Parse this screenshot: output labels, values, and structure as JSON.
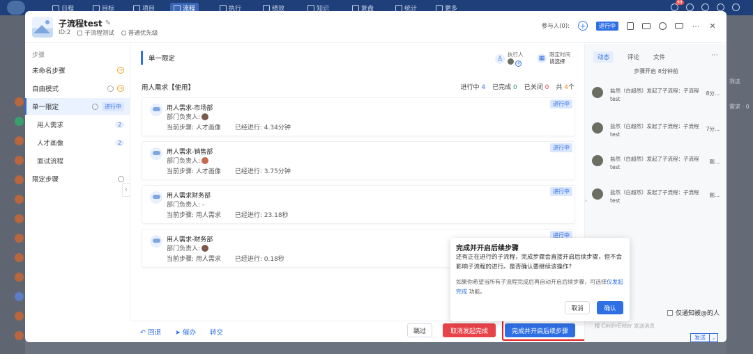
{
  "topnav": {
    "items": [
      {
        "label": "日程",
        "icon": "calendar-icon"
      },
      {
        "label": "目标",
        "icon": "target-icon"
      },
      {
        "label": "项目",
        "icon": "project-icon"
      },
      {
        "label": "流程",
        "icon": "flow-icon"
      },
      {
        "label": "执行",
        "icon": "execute-icon"
      },
      {
        "label": "绩效",
        "icon": "performance-icon"
      },
      {
        "label": "知识",
        "icon": "knowledge-icon"
      },
      {
        "label": "复盘",
        "icon": "review-icon"
      },
      {
        "label": "统计",
        "icon": "stats-icon"
      },
      {
        "label": "更多",
        "icon": "more-grid-icon"
      }
    ],
    "active": "流程",
    "badge": "99"
  },
  "background": {
    "right_filter": "筛选",
    "right_label": "需求 · 0"
  },
  "modal": {
    "title": "子流程test",
    "id_label": "ID:2",
    "type_label": "子流程测试",
    "priority_label": "普通优先级",
    "participants_label": "参与人(0):",
    "status_tag": "进行中"
  },
  "steps": {
    "heading": "步骤",
    "items": [
      {
        "label": "未命名步骤"
      },
      {
        "label": "自由模式"
      },
      {
        "label": "单一限定",
        "tag": "进行中"
      },
      {
        "label": "用人需求",
        "count": "2"
      },
      {
        "label": "人才画像",
        "count": "2"
      },
      {
        "label": "面试流程"
      },
      {
        "label": "限定步骤"
      }
    ]
  },
  "center": {
    "section_title": "单一限定",
    "executor_label": "执行人",
    "limit_time_label": "限定时间",
    "limit_time_value": "请选择",
    "demand_title": "用人需求【使用】",
    "stats": {
      "in_progress_label": "进行中",
      "in_progress": "4",
      "done_label": "已完成",
      "done": "0",
      "closed_label": "已关闭",
      "closed": "0",
      "total_label": "共",
      "total": "4",
      "total_unit": "个"
    },
    "cards": [
      {
        "name": "用人需求-市场部",
        "owner": "部门负责人:",
        "step": "当前步骤: 人才画像",
        "elapsed": "已经进行: 4.34分钟",
        "status": "进行中"
      },
      {
        "name": "用人需求-销售部",
        "owner": "部门负责人:",
        "step": "当前步骤: 人才画像",
        "elapsed": "已经进行: 3.75分钟",
        "status": "进行中"
      },
      {
        "name": "用人需求财务部",
        "owner": "部门负责人: -",
        "step": "当前步骤: 用人需求",
        "elapsed": "已经进行: 23.18秒",
        "status": "进行中"
      },
      {
        "name": "用人需求-财务部",
        "owner": "部门负责人:",
        "step": "当前步骤: 用人需求",
        "elapsed": "已经进行: 0.18秒",
        "status": "进行中"
      }
    ]
  },
  "footer": {
    "back": "回退",
    "urge": "催办",
    "transfer": "转交",
    "skip": "跳过",
    "cancel_start": "取消发起完成",
    "complete_next": "完成并开启后续步骤"
  },
  "rpanel": {
    "tabs": [
      "动态",
      "评论",
      "文件"
    ],
    "step_started": "步骤开启 8分钟前",
    "activities": [
      {
        "text": "盐然（白超然）发起了子流程：子流程test",
        "time": "8分..."
      },
      {
        "text": "盐然（白超然）发起了子流程：子流程test",
        "time": "7分..."
      },
      {
        "text": "盐然（白超然）发起了子流程：子流程test",
        "time": "刚..."
      },
      {
        "text": "盐然（白超然）发起了子流程：子流程test",
        "time": "刚..."
      }
    ],
    "notify_label": "仅通知被@的人",
    "input_hint": "按 Cmd+Enter 发送消息",
    "send": "发送"
  },
  "popover": {
    "title": "完成并开启后续步骤",
    "body": "还有正在进行的子流程，完成步骤会直接开启后续步骤，但不会影响子流程的进行。是否确认要继续该操作?",
    "sub_prefix": "如果你希望当所有子流程完成后再自动开启后续步骤，可选择",
    "sub_link": "仅发起完成",
    "sub_suffix": " 功能。",
    "cancel": "取消",
    "confirm": "确认"
  },
  "colors": {
    "accent": "#2f6fe4",
    "danger": "#e9434a",
    "highlight": "#e41c1c",
    "nav_bg": "#1f3f7a"
  }
}
